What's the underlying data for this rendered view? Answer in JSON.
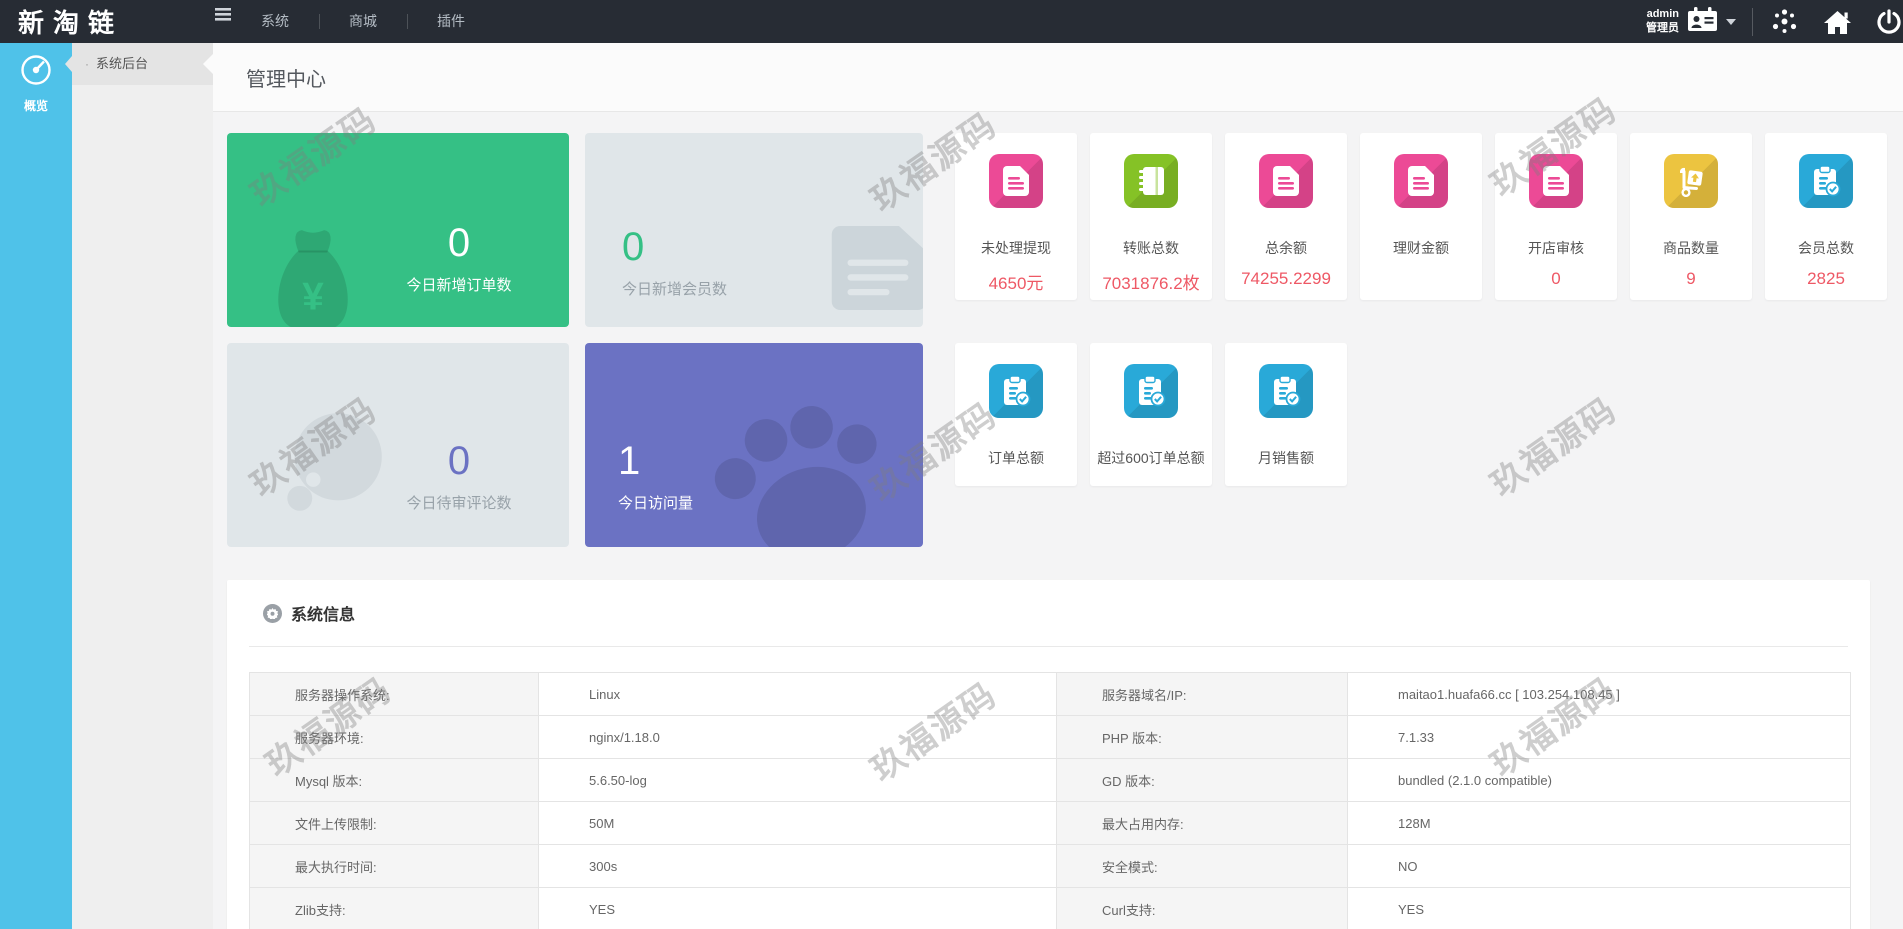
{
  "topbar": {
    "logo": "新淘链",
    "menu": [
      {
        "label": "系统"
      },
      {
        "label": "商城"
      },
      {
        "label": "插件"
      }
    ],
    "user": {
      "name": "admin",
      "role": "管理员"
    }
  },
  "sidebar": {
    "overview_label": "概览"
  },
  "submenu": {
    "bullet": "·",
    "item": "系统后台"
  },
  "page": {
    "title": "管理中心"
  },
  "watermark": {
    "text": "玖福源码"
  },
  "cards": [
    {
      "value": "0",
      "label": "今日新增订单数",
      "icon": "money-bag",
      "style": "green"
    },
    {
      "value": "0",
      "label": "今日新增会员数",
      "icon": "news-doc",
      "style": "gray"
    },
    {
      "value": "0",
      "label": "今日待审评论数",
      "icon": "comment-bubble",
      "style": "gray"
    },
    {
      "value": "1",
      "label": "今日访问量",
      "icon": "paw",
      "style": "purple"
    }
  ],
  "tiles1": [
    {
      "label": "未处理提现",
      "value": "4650元",
      "icon": "doc-pink"
    },
    {
      "label": "转账总数",
      "value": "7031876.2枚",
      "icon": "notebook-green"
    },
    {
      "label": "总余额",
      "value": "74255.2299",
      "icon": "doc-pink"
    },
    {
      "label": "理财金额",
      "value": "",
      "icon": "doc-pink"
    },
    {
      "label": "开店审核",
      "value": "0",
      "icon": "doc-pink"
    },
    {
      "label": "商品数量",
      "value": "9",
      "icon": "trolley-gold"
    },
    {
      "label": "会员总数",
      "value": "2825",
      "icon": "clipboard-check-blue"
    }
  ],
  "tiles2": [
    {
      "label": "订单总额",
      "icon": "clipboard-check-blue"
    },
    {
      "label": "超过600订单总额",
      "icon": "clipboard-check-blue"
    },
    {
      "label": "月销售额",
      "icon": "clipboard-check-blue"
    }
  ],
  "sysinfo": {
    "title": "系统信息",
    "rows": [
      {
        "k1": "服务器操作系统:",
        "v1": "Linux",
        "k2": "服务器域名/IP:",
        "v2": "maitao1.huafa66.cc [ 103.254.108.45 ]"
      },
      {
        "k1": "服务器环境:",
        "v1": "nginx/1.18.0",
        "k2": "PHP 版本:",
        "v2": "7.1.33"
      },
      {
        "k1": "Mysql 版本:",
        "v1": "5.6.50-log",
        "k2": "GD 版本:",
        "v2": "bundled (2.1.0 compatible)"
      },
      {
        "k1": "文件上传限制:",
        "v1": "50M",
        "k2": "最大占用内存:",
        "v2": "128M"
      },
      {
        "k1": "最大执行时间:",
        "v1": "300s",
        "k2": "安全模式:",
        "v2": "NO"
      },
      {
        "k1": "Zlib支持:",
        "v1": "YES",
        "k2": "Curl支持:",
        "v2": "YES"
      }
    ]
  },
  "colors": {
    "topbar_bg": "#272c34",
    "sidebar_blue": "#4fc2e9",
    "card_green": "#35c085",
    "card_gray": "#e0e6e9",
    "card_purple": "#6b72c3",
    "tile_pink": "#ec4a96",
    "tile_green": "#85c226",
    "tile_gold": "#ecc440",
    "tile_blue": "#29a9d8",
    "value_red": "#ee5865"
  }
}
